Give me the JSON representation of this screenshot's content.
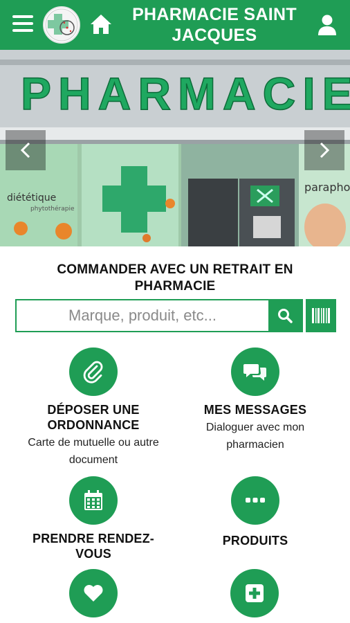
{
  "header": {
    "title_line1": "PHARMACIE SAINT",
    "title_line2": "JACQUES"
  },
  "hero": {
    "sign_text": "PHARMACIE",
    "left_window": "diététique",
    "left_window_small": "phytothérapie",
    "right_window": "parapho"
  },
  "order": {
    "title_line1": "COMMANDER AVEC UN RETRAIT EN",
    "title_line2": "PHARMACIE",
    "search_placeholder": "Marque, produit, etc..."
  },
  "tiles": {
    "prescription": {
      "title_line1": "DÉPOSER UNE",
      "title_line2": "ORDONNANCE",
      "sub_line1": "Carte de mutuelle ou autre",
      "sub_line2": "document"
    },
    "messages": {
      "title": "MES MESSAGES",
      "sub_line1": "Dialoguer avec mon",
      "sub_line2": "pharmacien"
    },
    "appointment": {
      "title_line1": "PRENDRE RENDEZ-",
      "title_line2": "VOUS"
    },
    "products": {
      "title": "PRODUITS"
    }
  },
  "colors": {
    "brand_green": "#1f9d55"
  },
  "icons": [
    "menu-icon",
    "pharmacy-logo",
    "home-icon",
    "user-icon",
    "chevron-left-icon",
    "chevron-right-icon",
    "search-icon",
    "barcode-icon",
    "paperclip-icon",
    "chat-icon",
    "calendar-icon",
    "ellipsis-icon",
    "heart-icon",
    "plus-square-icon"
  ]
}
